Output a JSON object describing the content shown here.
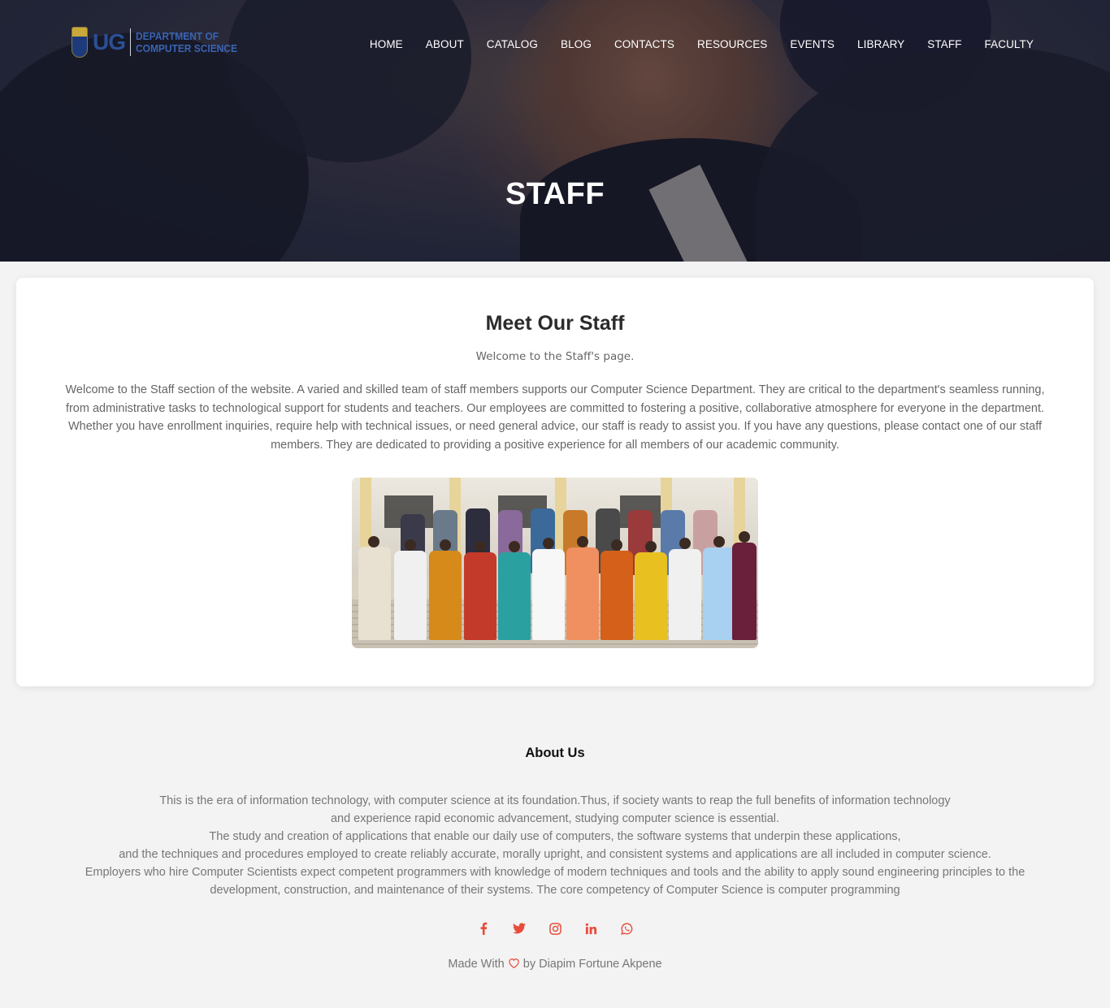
{
  "logo": {
    "mark": "UG",
    "dept_line1": "DEPARTMENT OF",
    "dept_line2": "COMPUTER SCIENCE"
  },
  "nav": [
    "HOME",
    "ABOUT",
    "CATALOG",
    "BLOG",
    "CONTACTS",
    "RESOURCES",
    "EVENTS",
    "LIBRARY",
    "STAFF",
    "FACULTY"
  ],
  "hero": {
    "title": "STAFF"
  },
  "card": {
    "heading": "Meet Our Staff",
    "subheading": "Welcome to the Staff's page.",
    "body": "Welcome to the Staff section of the website. A varied and skilled team of staff members supports our Computer Science Department. They are critical to the department's seamless running, from administrative tasks to technological support for students and teachers. Our employees are committed to fostering a positive, collaborative atmosphere for everyone in the department. Whether you have enrollment inquiries, require help with technical issues, or need general advice, our staff is ready to assist you. If you have any questions, please contact one of our staff members. They are dedicated to providing a positive experience for all members of our academic community."
  },
  "footer": {
    "heading": "About Us",
    "about_lines": [
      "This is the era of information technology, with computer science at its foundation.Thus, if society wants to reap the full benefits of information technology",
      "and experience rapid economic advancement, studying computer science is essential.",
      "The study and creation of applications that enable our daily use of computers, the software systems that underpin these applications,",
      "and the techniques and procedures employed to create reliably accurate, morally upright, and consistent systems and applications are all included in computer science.",
      "Employers who hire Computer Scientists expect competent programmers with knowledge of modern techniques and tools and the ability to apply sound engineering principles to the",
      "development, construction, and maintenance of their systems. The core competency of Computer Science is computer programming"
    ],
    "social_icons": [
      "facebook-icon",
      "twitter-icon",
      "instagram-icon",
      "linkedin-icon",
      "whatsapp-icon"
    ],
    "credit_prefix": "Made With",
    "credit_suffix": "by Diapim Fortune Akpene"
  },
  "colors": {
    "accent": "#e74c3c",
    "logo_blue": "#2c4f96"
  }
}
